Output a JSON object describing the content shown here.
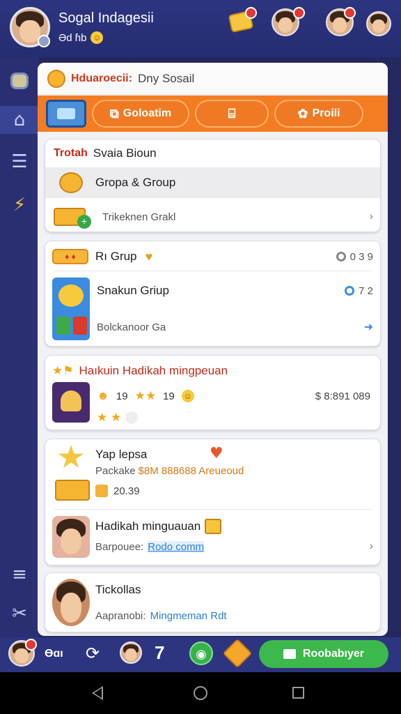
{
  "header": {
    "title": "Sogal Indagesii",
    "user_stats": "Əd ɦb",
    "notification_badges": [
      "",
      "",
      "",
      ""
    ]
  },
  "panel": {
    "title_accent": "Hduaroecii:",
    "title_rest": "Dny Sosail"
  },
  "tabs": [
    {
      "label": "",
      "icon": "screen-icon"
    },
    {
      "label": "Goloatim",
      "icon": "share-icon"
    },
    {
      "label": "",
      "icon": "bag-icon"
    },
    {
      "label": "Proili",
      "icon": "puzzle-icon"
    }
  ],
  "card1": {
    "accent": "Trotah",
    "title": "Svaia Bioun",
    "selected_label": "Gropa & Group",
    "sub_label": "Trikeknen Grakl"
  },
  "card2": {
    "header_label": "Rı Grup",
    "header_count": "0 3 9",
    "row1_label": "Snakun Griup",
    "row1_count": "7 2",
    "row2_label": "Bolckanoor Ga"
  },
  "card3": {
    "title": "Haıkuin Hadikah mingpeuan",
    "stat_a": "19",
    "stat_b": "19",
    "money": "$ 8:891 089"
  },
  "card4": {
    "title": "Yap lepsa",
    "subtitle": "Packake",
    "subtitle_orange": "$8M 888688 Areueoud",
    "price": "20.39",
    "title2": "Hadikah minguauan",
    "detail": "Barpouee:",
    "detail_link": "Rodo comm"
  },
  "card5": {
    "title": "Tickollas",
    "detail": "Aapranobi:",
    "detail_blue": "Mingmeman Rdt"
  },
  "bottombar": {
    "text": "Ɵɑı",
    "level": "7",
    "cta_label": "Roobabıyer"
  },
  "colors": {
    "background": "#24285f",
    "tab_orange": "#f47c22",
    "accent_red": "#c32b1a",
    "cta_green": "#3db84d"
  }
}
